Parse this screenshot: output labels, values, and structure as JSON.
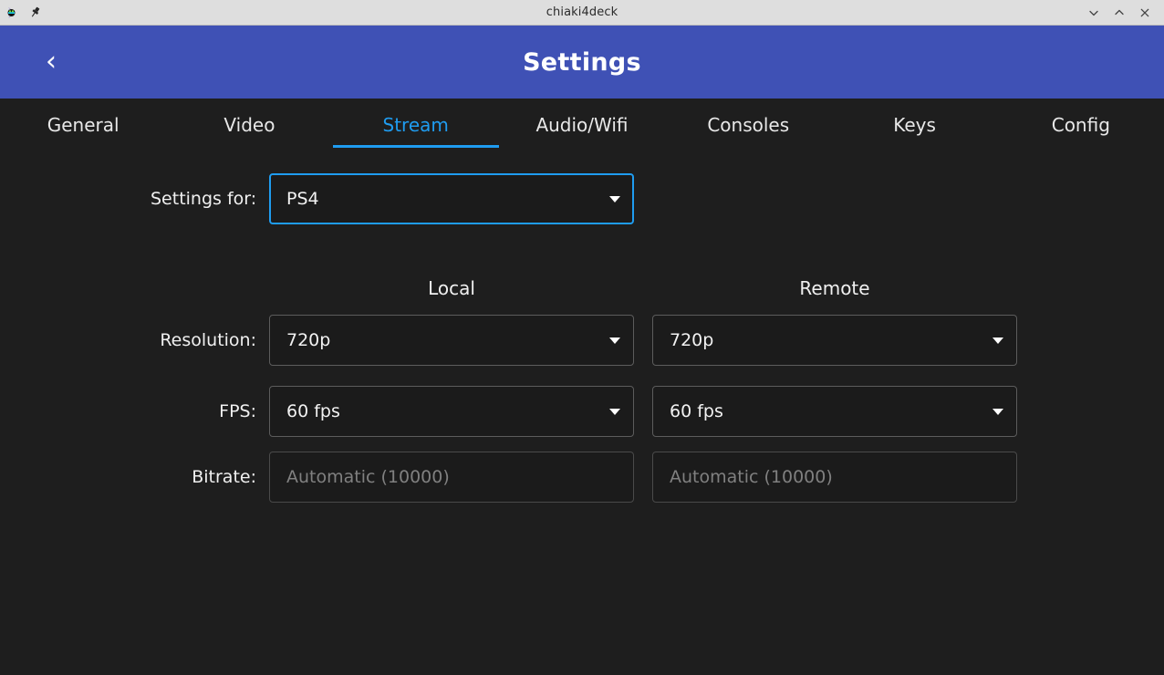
{
  "window": {
    "title": "chiaki4deck",
    "icons": {
      "app": "app-logo-icon",
      "pin": "pin-icon"
    },
    "controls": {
      "minimize": "chevron-down-icon",
      "maximize": "chevron-up-icon",
      "close": "close-icon"
    }
  },
  "header": {
    "title": "Settings",
    "back_glyph": "‹",
    "back_icon": "chevron-left-icon",
    "background": "#3f51b5"
  },
  "tabs": {
    "accent": "#1f9cf0",
    "active": "Stream",
    "items": [
      {
        "label": "General",
        "active": false
      },
      {
        "label": "Video",
        "active": false
      },
      {
        "label": "Stream",
        "active": true
      },
      {
        "label": "Audio/Wifi",
        "active": false
      },
      {
        "label": "Consoles",
        "active": false
      },
      {
        "label": "Keys",
        "active": false
      },
      {
        "label": "Config",
        "active": false
      }
    ]
  },
  "form": {
    "settings_for": {
      "label": "Settings for:",
      "value": "PS4",
      "focused": true
    },
    "columns": [
      {
        "title": "Local"
      },
      {
        "title": "Remote"
      }
    ],
    "rows": [
      {
        "label": "Resolution:",
        "type": "dropdown",
        "local": {
          "value": "720p"
        },
        "remote": {
          "value": "720p"
        }
      },
      {
        "label": "FPS:",
        "type": "dropdown",
        "local": {
          "value": "60 fps"
        },
        "remote": {
          "value": "60 fps"
        }
      },
      {
        "label": "Bitrate:",
        "type": "text",
        "local": {
          "value": "",
          "placeholder": "Automatic (10000)"
        },
        "remote": {
          "value": "",
          "placeholder": "Automatic (10000)"
        }
      }
    ]
  },
  "colors": {
    "background": "#1e1e1e",
    "field_background": "#1b1b1b",
    "accent": "#1f9cf0",
    "header": "#3f51b5",
    "titlebar": "#dedede",
    "placeholder": "#808080"
  }
}
